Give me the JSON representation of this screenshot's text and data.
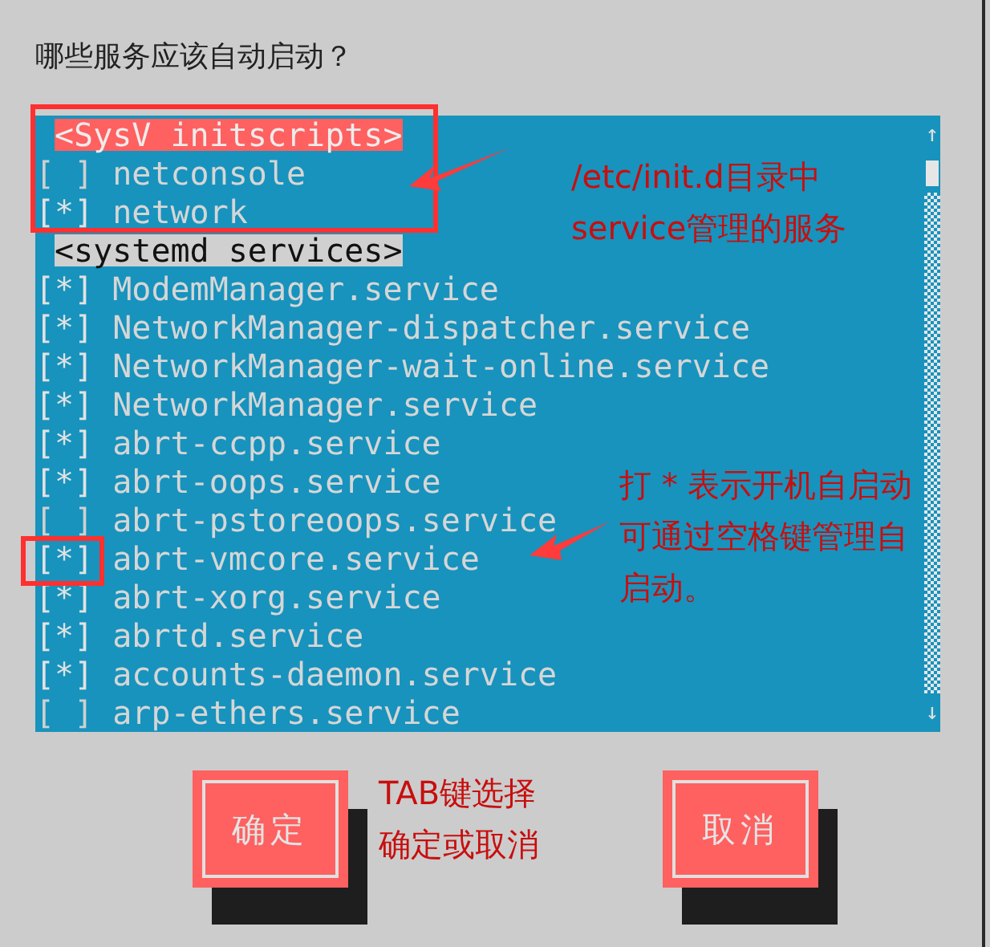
{
  "prompt": "哪些服务应该自动启动？",
  "services": [
    {
      "kind": "header",
      "label": "<SysV initscripts>",
      "selected": true
    },
    {
      "kind": "item",
      "box": "[ ]",
      "label": "netconsole",
      "checked": false
    },
    {
      "kind": "item",
      "box": "[*]",
      "label": "network",
      "checked": true
    },
    {
      "kind": "header",
      "label": "<systemd services>",
      "selected": false
    },
    {
      "kind": "item",
      "box": "[*]",
      "label": "ModemManager.service",
      "checked": true
    },
    {
      "kind": "item",
      "box": "[*]",
      "label": "NetworkManager-dispatcher.service",
      "checked": true
    },
    {
      "kind": "item",
      "box": "[*]",
      "label": "NetworkManager-wait-online.service",
      "checked": true
    },
    {
      "kind": "item",
      "box": "[*]",
      "label": "NetworkManager.service",
      "checked": true
    },
    {
      "kind": "item",
      "box": "[*]",
      "label": "abrt-ccpp.service",
      "checked": true
    },
    {
      "kind": "item",
      "box": "[*]",
      "label": "abrt-oops.service",
      "checked": true
    },
    {
      "kind": "item",
      "box": "[ ]",
      "label": "abrt-pstoreoops.service",
      "checked": false
    },
    {
      "kind": "item",
      "box": "[*]",
      "label": "abrt-vmcore.service",
      "checked": true
    },
    {
      "kind": "item",
      "box": "[*]",
      "label": "abrt-xorg.service",
      "checked": true
    },
    {
      "kind": "item",
      "box": "[*]",
      "label": "abrtd.service",
      "checked": true
    },
    {
      "kind": "item",
      "box": "[*]",
      "label": "accounts-daemon.service",
      "checked": true
    },
    {
      "kind": "item",
      "box": "[ ]",
      "label": "arp-ethers.service",
      "checked": false
    }
  ],
  "scrollbar": {
    "up": "↑",
    "down": "↓"
  },
  "buttons": [
    {
      "label": "确定"
    },
    {
      "label": "取消"
    }
  ],
  "annotations": [
    {
      "kind": "note",
      "lines": [
        "/etc/init.d目录中",
        "service管理的服务"
      ]
    },
    {
      "kind": "note",
      "lines": [
        "打 * 表示开机自启动",
        "可通过空格键管理自",
        "启动。"
      ]
    },
    {
      "kind": "note",
      "lines": [
        "TAB键选择",
        "确定或取消"
      ]
    }
  ]
}
